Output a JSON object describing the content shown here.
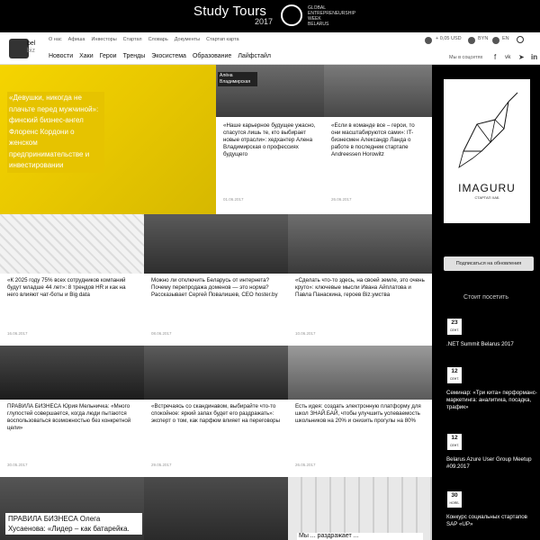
{
  "banner": {
    "title": "Study Tours",
    "year": "2017",
    "org_lines": [
      "GLOBAL",
      "ENTREPRENEURSHIP",
      "WEEK",
      "BELARUS"
    ]
  },
  "site": {
    "logo_line1": "bel",
    "logo_line2": "biz"
  },
  "top_nav": [
    "О нас",
    "Афиша",
    "Инвесторы",
    "Стартап",
    "Словарь",
    "Документы",
    "Стартап карта"
  ],
  "main_nav": [
    "Новости",
    "Хаки",
    "Герои",
    "Тренды",
    "Экосистема",
    "Образование",
    "Лайфстайл"
  ],
  "rates": {
    "weather": "+ 0,05 USD",
    "byn_label": "BYN",
    "eur_label": "EN"
  },
  "social_label": "Мы в соцсетях",
  "social_icons": [
    "facebook-icon",
    "vk-icon",
    "telegram-icon",
    "linkedin-icon"
  ],
  "articles": [
    {
      "caption": "«Девушки, никогда не плачьте перед мужчиной»: финский бизнес-ангел Флоренс Кордони о женском предпринимательстве и инвестировании",
      "date": ""
    },
    {
      "caption": "«Наше карьерное будущее ужасно, спасутся лишь те, кто выбирает новые отрасли»: хедхантер Алена Владимирская о профессиях будущего",
      "date": "01.06.2017",
      "tag": "Алёна Владимирская"
    },
    {
      "caption": "«Если в команде все – герои, то они масштабируются сами»: IT-бизнесмен Александр Ланда о работе в последнем стартапе Andreessen Horowitz",
      "date": "26.06.2017"
    },
    {
      "caption": "«К 2025 году 75% всех сотрудников компаний будут младше 44 лет»: 8 трендов HR и как на него влияют чат-боты и Big data",
      "date": "16.06.2017"
    },
    {
      "caption": "Можно ли отключить Беларусь от интернета? Почему перепродажа доменов — это норма? Рассказывает Сергей Повалишев, CEO hoster.by",
      "date": "08.06.2017"
    },
    {
      "caption": "«Сделать что-то здесь, на своей земле, это очень круто»: ключевые мысли Ивана Айплатова и Павла Панаскина, героев Biz.умства",
      "date": "10.06.2017"
    },
    {
      "caption": "ПРАВИЛА БИЗНЕСА Юрия Мельничка: «Много глупостей совершается, когда люди пытаются воспользоваться возможностью без конкретной цели»",
      "date": "30.05.2017"
    },
    {
      "caption": "«Встречаясь со скандинавом, выбирайте что-то спокойное: яркий запах будет его раздражать»: эксперт о том, как парфюм влияет на переговоры",
      "date": "29.05.2017"
    },
    {
      "caption": "Есть идея: создать электронную платформу для школ ЗНАЙ.БАЙ, чтобы улучшить успеваемость школьников на 20% и снизить прогулы на 80%",
      "date": "26.05.2017"
    },
    {
      "caption": "ПРАВИЛА БИЗНЕСА Олега Хусаенова: «Лидер – как батарейка.",
      "date": ""
    },
    {
      "caption": "",
      "date": ""
    },
    {
      "caption": "Мы ... раздражает ...",
      "date": ""
    }
  ],
  "sidebar": {
    "ad_brand": "IMAGURU",
    "ad_sub": "СТАРТАП ХАБ",
    "subscribe": "Подписаться на обновления",
    "visit_title": "Стоит посетить",
    "events": [
      {
        "day": "23",
        "month": "СЕНТ.",
        "title": ".NET Summit Belarus 2017"
      },
      {
        "day": "12",
        "month": "СЕНТ.",
        "title": "Семинар: «Три кита» перформанс-маркетинга: аналитика, посадка, трафик»"
      },
      {
        "day": "12",
        "month": "СЕНТ.",
        "title": "Belarus Azure User Group Meetup #09.2017"
      },
      {
        "day": "30",
        "month": "НОЯБ.",
        "title": "Конкурс социальных стартапов SAP «UP»"
      }
    ]
  },
  "colors": {
    "accent_yellow": "#f5d400",
    "dark": "#000000"
  }
}
